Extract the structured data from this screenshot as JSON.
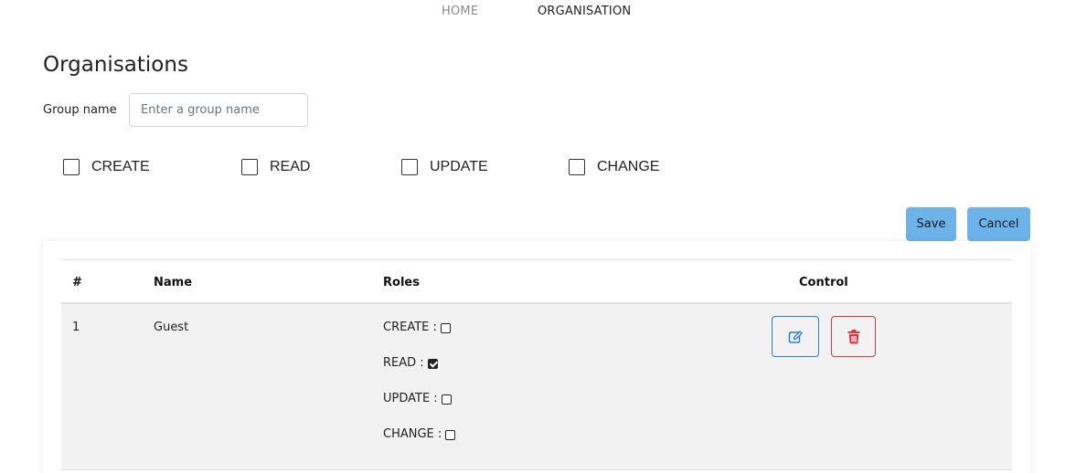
{
  "nav": {
    "home": "HOME",
    "organisation": "ORGANISATION"
  },
  "page": {
    "title": "Organisations"
  },
  "form": {
    "group_label": "Group name",
    "group_placeholder": "Enter a group name",
    "group_value": "",
    "permissions": [
      {
        "label": "CREATE",
        "checked": false
      },
      {
        "label": "READ",
        "checked": false
      },
      {
        "label": "UPDATE",
        "checked": false
      },
      {
        "label": "CHANGE",
        "checked": false
      }
    ],
    "save_label": "Save",
    "cancel_label": "Cancel"
  },
  "table": {
    "headers": [
      "#",
      "Name",
      "Roles",
      "Control"
    ],
    "rows": [
      {
        "num": "1",
        "name": "Guest",
        "roles": [
          {
            "label": "CREATE :",
            "checked": false
          },
          {
            "label": "READ :",
            "checked": true
          },
          {
            "label": "UPDATE :",
            "checked": false
          },
          {
            "label": "CHANGE :",
            "checked": false
          }
        ],
        "controls": [
          "edit-icon",
          "trash-icon"
        ]
      }
    ]
  },
  "colors": {
    "button_bg": "#6cb3e9",
    "edit_accent": "#2f7fcf",
    "delete_accent": "#dc3545",
    "row_bg": "#f2f2f2"
  }
}
